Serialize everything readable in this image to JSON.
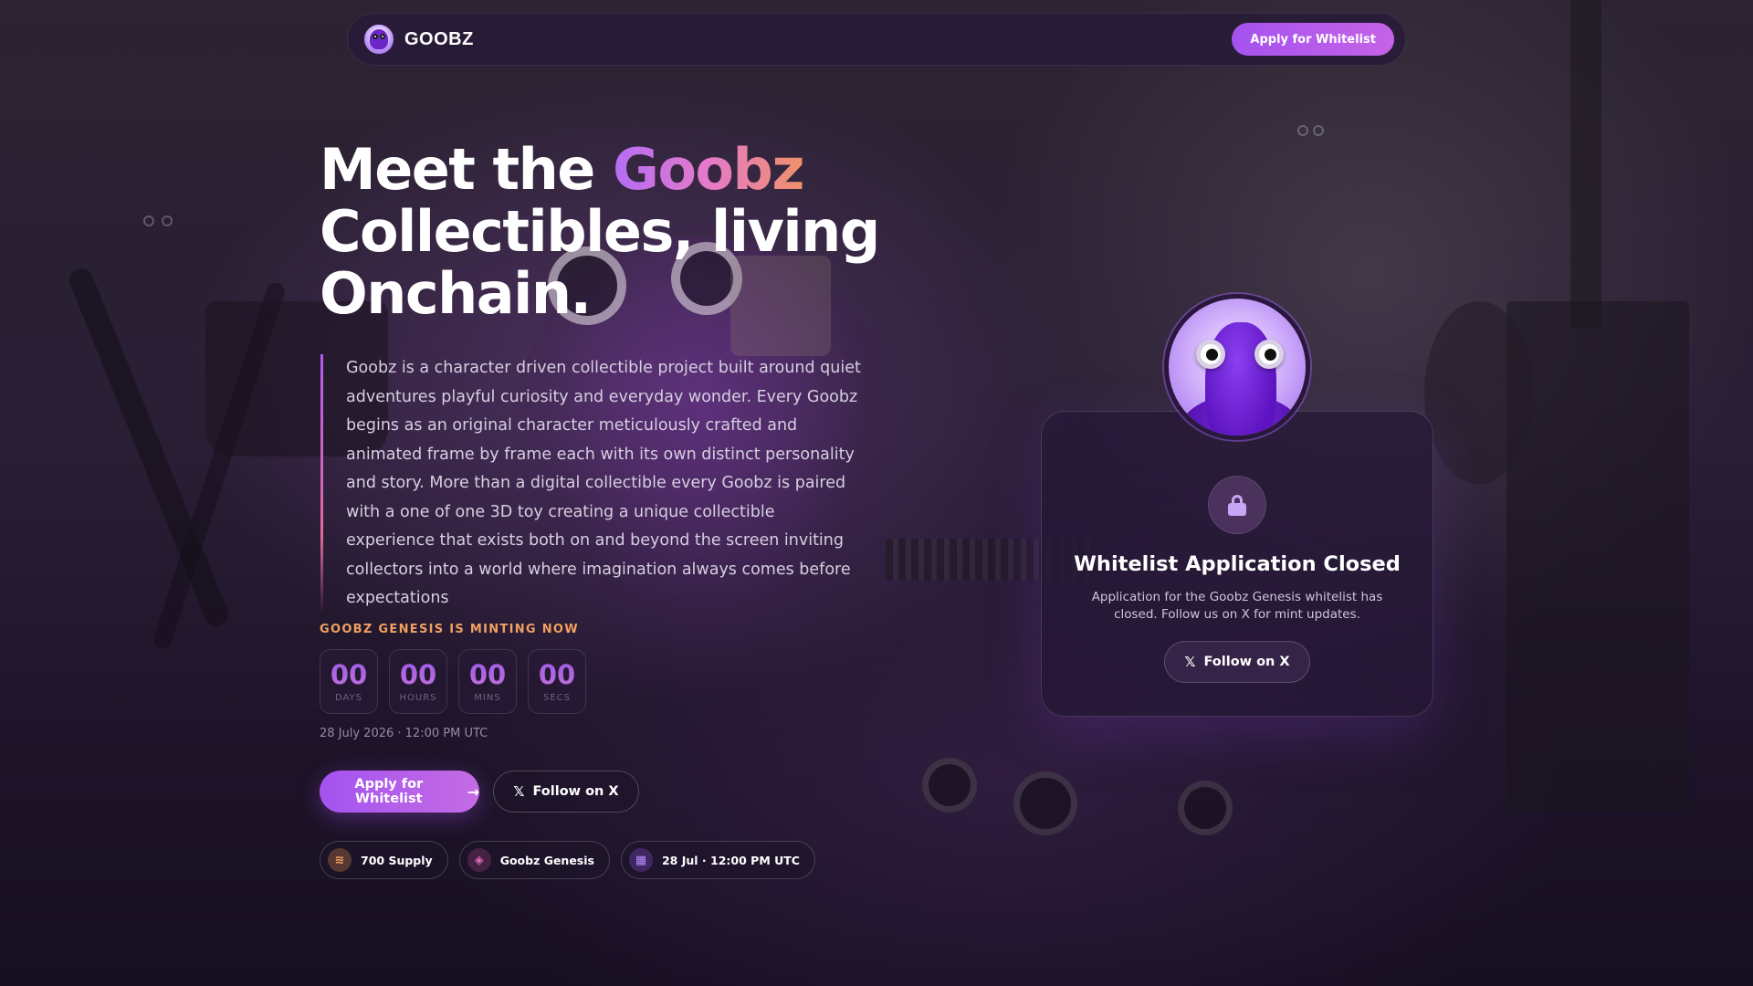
{
  "nav": {
    "brand": "GOOBZ",
    "cta_label": "Apply for Whitelist"
  },
  "hero": {
    "title_part1": "Meet the ",
    "title_highlight": "Goobz",
    "title_part2": "Collectibles, living",
    "title_part3": "Onchain.",
    "description": "Goobz is a character driven collectible project built around quiet adventures playful curiosity and everyday wonder. Every Goobz begins as an original character meticulously crafted and animated frame by frame each with its own distinct personality and story. More than a digital collectible every Goobz is paired with a one of one 3D toy creating a unique collectible experience that exists both on and beyond the screen inviting collectors into a world where imagination always comes before expectations"
  },
  "countdown": {
    "label": "GOOBZ GENESIS IS MINTING NOW",
    "units": [
      {
        "value": "00",
        "unit": "DAYS"
      },
      {
        "value": "00",
        "unit": "HOURS"
      },
      {
        "value": "00",
        "unit": "MINS"
      },
      {
        "value": "00",
        "unit": "SECS"
      }
    ],
    "date_text": "28 July 2026 · 12:00 PM UTC"
  },
  "cta": {
    "primary_label": "Apply for Whitelist",
    "primary_icon": "arrow-right-icon",
    "secondary_label": "Follow on X",
    "secondary_icon": "x-logo-icon"
  },
  "chips": [
    {
      "label": "700 Supply",
      "icon": "stack-icon",
      "color": "#f2a45c"
    },
    {
      "label": "Goobz Genesis",
      "icon": "eye-icon",
      "color": "#e36eb3"
    },
    {
      "label": "28 Jul · 12:00 PM UTC",
      "icon": "calendar-icon",
      "color": "#b58cf7"
    }
  ],
  "card": {
    "title": "Whitelist Application Closed",
    "text": "Application for the Goobz Genesis whitelist has closed. Follow us on X for mint updates.",
    "button_label": "Follow on X",
    "icon": "lock-icon"
  },
  "colors": {
    "accent": "#a552f0",
    "accent_pink": "#c663e6",
    "minting_label": "#f0a060"
  }
}
